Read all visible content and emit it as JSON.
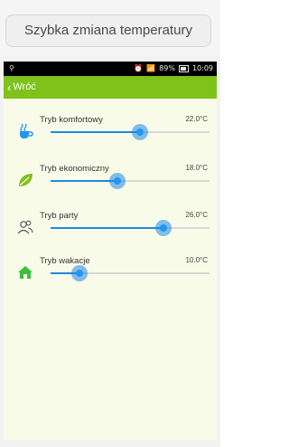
{
  "page": {
    "title": "Szybka zmiana temperatury"
  },
  "status_bar": {
    "left_icon": "usb-icon",
    "battery": "89%",
    "time": "10:09"
  },
  "app_bar": {
    "back_label": "Wróć"
  },
  "modes": [
    {
      "label": "Tryb komfortowy",
      "temp": "22.0°C",
      "icon": "coffee-icon",
      "level": 0.56
    },
    {
      "label": "Tryb ekonomiczny",
      "temp": "18.0°C",
      "icon": "leaf-icon",
      "level": 0.42
    },
    {
      "label": "Tryb party",
      "temp": "26.0°C",
      "icon": "people-icon",
      "level": 0.71
    },
    {
      "label": "Tryb wakacje",
      "temp": "10.0°C",
      "icon": "home-icon",
      "level": 0.18
    }
  ],
  "colors": {
    "accent": "#7ec21a",
    "slider": "#2196f3",
    "background": "#f9fbe9"
  }
}
